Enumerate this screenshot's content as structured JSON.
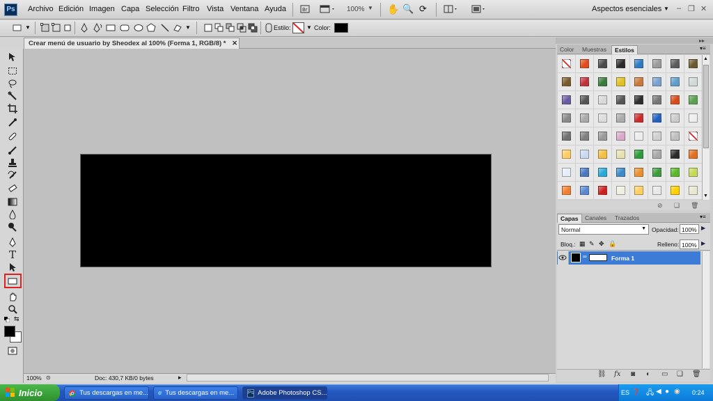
{
  "app": {
    "logo": "Ps",
    "menus": [
      "Archivo",
      "Edición",
      "Imagen",
      "Capa",
      "Selección",
      "Filtro",
      "Vista",
      "Ventana",
      "Ayuda"
    ],
    "zoom": "100%",
    "workspace": "Aspectos esenciales"
  },
  "options_bar": {
    "style_label": "Estilo:",
    "color_label": "Color:",
    "color": "#000000"
  },
  "document": {
    "tab_title": "Crear menú de usuario by Sheodex al 100% (Forma 1, RGB/8) *",
    "status_zoom": "100%",
    "status_doc": "Doc: 430,7 KB/0 bytes",
    "canvas_color": "#000000"
  },
  "styles_panel": {
    "tabs": [
      "Color",
      "Muestras",
      "Estilos"
    ],
    "active_tab": "Estilos",
    "swatches": [
      "none",
      "#e24b1a",
      "#4a4a4a",
      "#2b2b2b",
      "#2e79c4",
      "#9a9a9a",
      "#5b5b5b",
      "#6b5a2e",
      "#7a5a2a",
      "#c0303a",
      "#3a7a3a",
      "#e0c020",
      "#c87a3a",
      "#7aa0d0",
      "#5f9ec8",
      "#d0d8d8",
      "#6a5aa0",
      "#555555",
      "#d8d8d8",
      "#555555",
      "#2c2c2c",
      "#777777",
      "#d84a1a",
      "#5aa050",
      "#8a8a8a",
      "#aaaaaa",
      "#dddddd",
      "#aaaaaa",
      "#cc2a2a",
      "#2060c0",
      "#cccccc",
      "#eeeeee",
      "#707070",
      "#808080",
      "#999999",
      "#d8a8c8",
      "#ededed",
      "#cfcfcf",
      "#bfbfbf",
      "none",
      "#ffcc66",
      "#c8d8f0",
      "#f2c040",
      "#e8e0b0",
      "#2c9a3a",
      "#a8a8a8",
      "#2a2a2a",
      "#e07020",
      "#e8eef8",
      "#4a78c0",
      "#2aa8d8",
      "#3a8ac8",
      "#e89030",
      "#3c9a3c",
      "#58b828",
      "#c8d858",
      "#f08030",
      "#5a88d0",
      "#cc2020",
      "#f0f0e0",
      "#ffd060",
      "#e8e8e8",
      "#ffd000",
      "#e8e8d0"
    ]
  },
  "layers_panel": {
    "tabs": [
      "Capas",
      "Canales",
      "Trazados"
    ],
    "active_tab": "Capas",
    "blend_mode": "Normal",
    "opacity_label": "Opacidad:",
    "opacity": "100%",
    "lock_label": "Bloq.:",
    "fill_label": "Relleno:",
    "fill": "100%",
    "layers": [
      {
        "name": "Forma 1"
      }
    ]
  },
  "taskbar": {
    "start": "Inicio",
    "items": [
      "Tus descargas en me...",
      "Tus descargas en me...",
      "Adobe Photoshop CS..."
    ],
    "language": "ES",
    "clock": "0:24"
  }
}
